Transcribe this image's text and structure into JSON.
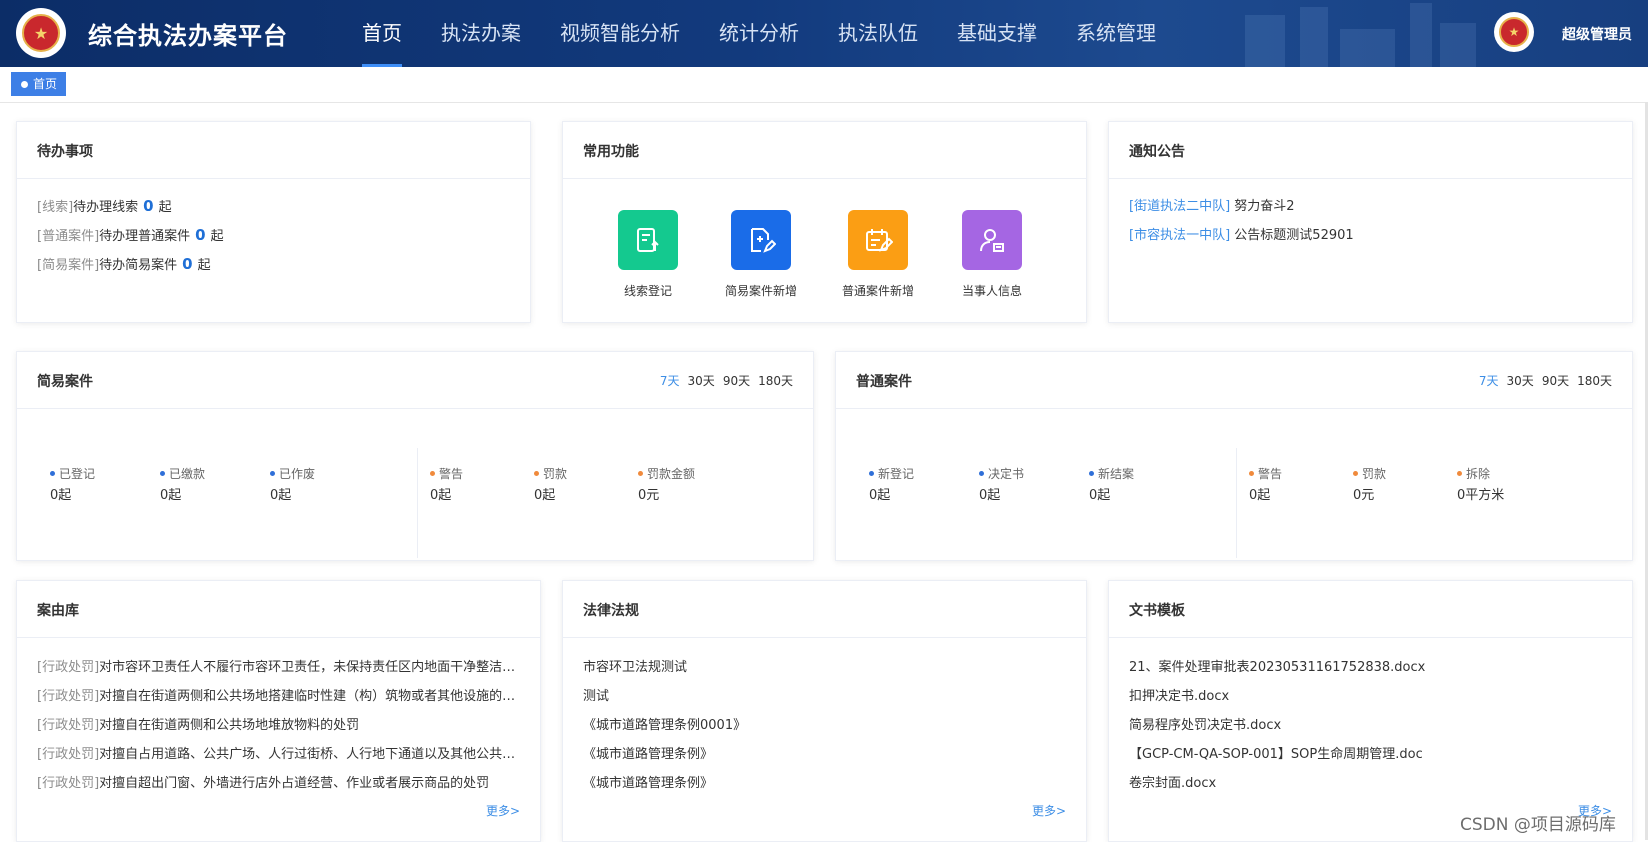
{
  "header": {
    "app_title": "综合执法办案平台",
    "nav": [
      "首页",
      "执法办案",
      "视频智能分析",
      "统计分析",
      "执法队伍",
      "基础支撑",
      "系统管理"
    ],
    "active_nav": 0,
    "user_name": "超级管理员"
  },
  "breadcrumb": {
    "tab": "首页"
  },
  "todo": {
    "title": "待办事项",
    "items": [
      {
        "category": "[线索]",
        "text": "待办理线索",
        "count": "0",
        "unit": "起"
      },
      {
        "category": "[普通案件]",
        "text": "待办理普通案件",
        "count": "0",
        "unit": "起"
      },
      {
        "category": "[简易案件]",
        "text": "待办简易案件",
        "count": "0",
        "unit": "起"
      }
    ]
  },
  "functions": {
    "title": "常用功能",
    "items": [
      {
        "label": "线索登记",
        "color": "#14c98f",
        "icon": "clipboard-upload-icon"
      },
      {
        "label": "简易案件新增",
        "color": "#1a6ce8",
        "icon": "document-edit-icon"
      },
      {
        "label": "普通案件新增",
        "color": "#fb9e14",
        "icon": "calendar-edit-icon"
      },
      {
        "label": "当事人信息",
        "color": "#a566e3",
        "icon": "user-document-icon"
      }
    ]
  },
  "notices": {
    "title": "通知公告",
    "items": [
      {
        "source": "[街道执法二中队]",
        "text": "努力奋斗2"
      },
      {
        "source": "[市容执法一中队]",
        "text": "公告标题测试52901"
      }
    ]
  },
  "simple_cases": {
    "title": "简易案件",
    "periods": [
      "7天",
      "30天",
      "90天",
      "180天"
    ],
    "active_period": 0,
    "left": [
      {
        "label": "已登记",
        "value": "0起"
      },
      {
        "label": "已缴款",
        "value": "0起"
      },
      {
        "label": "已作废",
        "value": "0起"
      }
    ],
    "right": [
      {
        "label": "警告",
        "value": "0起"
      },
      {
        "label": "罚款",
        "value": "0起"
      },
      {
        "label": "罚款金额",
        "value": "0元"
      }
    ]
  },
  "normal_cases": {
    "title": "普通案件",
    "periods": [
      "7天",
      "30天",
      "90天",
      "180天"
    ],
    "active_period": 0,
    "left": [
      {
        "label": "新登记",
        "value": "0起"
      },
      {
        "label": "决定书",
        "value": "0起"
      },
      {
        "label": "新结案",
        "value": "0起"
      }
    ],
    "right": [
      {
        "label": "警告",
        "value": "0起"
      },
      {
        "label": "罚款",
        "value": "0元"
      },
      {
        "label": "拆除",
        "value": "0平方米"
      }
    ]
  },
  "stat_colors": {
    "left": "#2f6fd8",
    "right": "#f08a3c"
  },
  "case_library": {
    "title": "案由库",
    "items": [
      {
        "category": "[行政处罚]",
        "text": "对市容环卫责任人不履行市容环卫责任，未保持责任区内地面干净整洁的处罚"
      },
      {
        "category": "[行政处罚]",
        "text": "对擅自在街道两侧和公共场地搭建临时性建（构）筑物或者其他设施的处罚"
      },
      {
        "category": "[行政处罚]",
        "text": "对擅自在街道两侧和公共场地堆放物料的处罚"
      },
      {
        "category": "[行政处罚]",
        "text": "对擅自占用道路、公共广场、人行过街桥、人行地下通道以及其他公共场所的处罚"
      },
      {
        "category": "[行政处罚]",
        "text": "对擅自超出门窗、外墙进行店外占道经营、作业或者展示商品的处罚"
      }
    ],
    "more": "更多>"
  },
  "laws": {
    "title": "法律法规",
    "items": [
      "市容环卫法规测试",
      "测试",
      "《城市道路管理条例0001》",
      "《城市道路管理条例》",
      "《城市道路管理条例》"
    ],
    "more": "更多>"
  },
  "templates": {
    "title": "文书模板",
    "items": [
      "21、案件处理审批表20230531161752838.docx",
      "扣押决定书.docx",
      "简易程序处罚决定书.docx",
      "【GCP-CM-QA-SOP-001】SOP生命周期管理.doc",
      "卷宗封面.docx"
    ],
    "more": "更多>"
  },
  "watermark": "CSDN @项目源码库"
}
